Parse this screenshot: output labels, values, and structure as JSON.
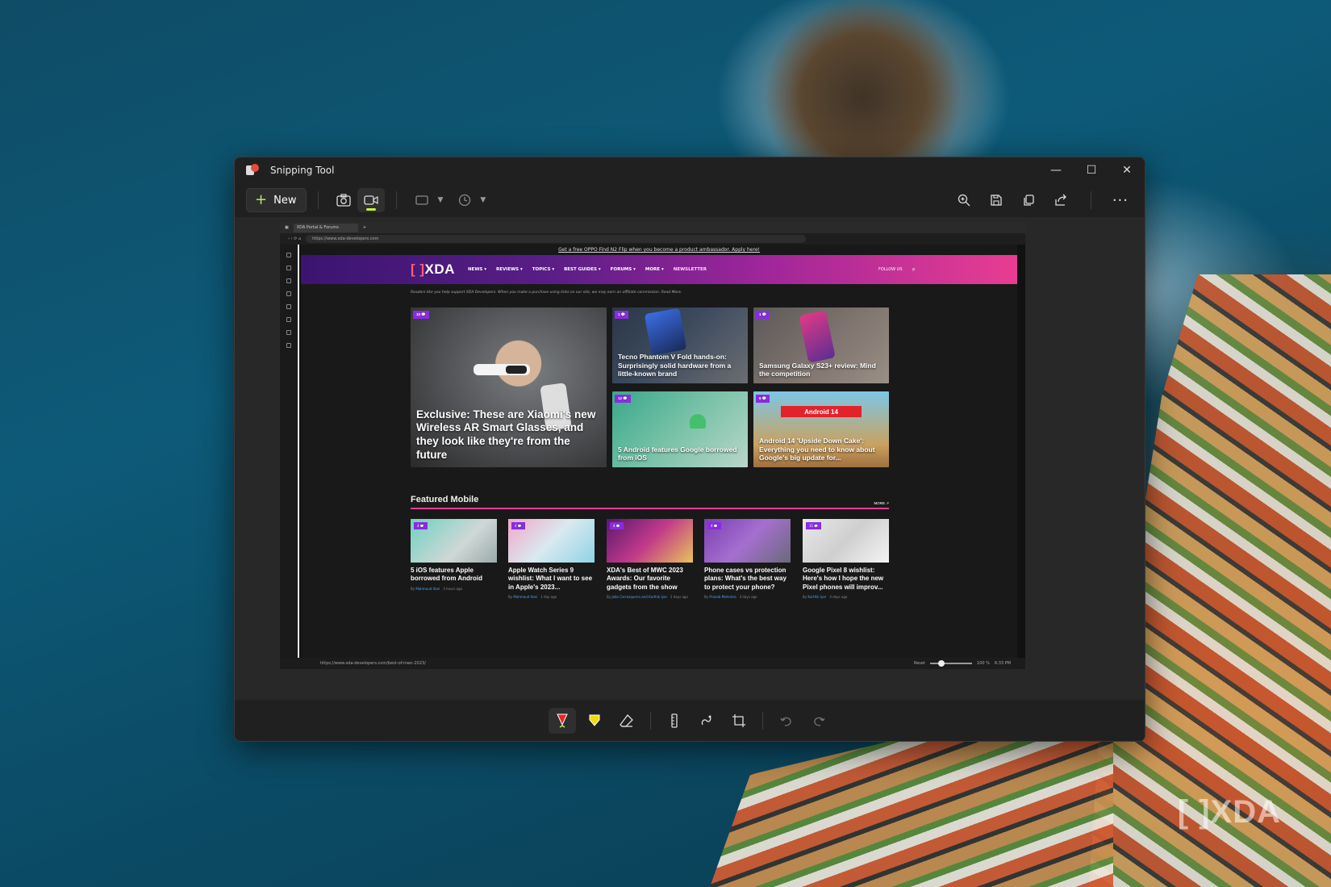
{
  "window": {
    "title": "Snipping Tool",
    "controls": {
      "minimize": "—",
      "maximize": "☐",
      "close": "✕"
    }
  },
  "toolbar": {
    "new_label": "New",
    "new_icon": "plus-icon",
    "tools": [
      "camera-icon",
      "video-icon",
      "rectangle-mode-icon",
      "timer-icon"
    ],
    "right_tools": [
      "zoom-in-icon",
      "save-icon",
      "copy-icon",
      "share-icon",
      "more-icon"
    ],
    "active_mode": "video",
    "accent": "#c6f23a"
  },
  "annotation_bar": {
    "tools": [
      "ballpoint-pen-icon",
      "highlighter-icon",
      "eraser-icon",
      "ruler-icon",
      "touch-writing-icon",
      "crop-icon",
      "undo-icon",
      "redo-icon"
    ],
    "active": "ballpoint-pen-icon"
  },
  "browser": {
    "tab_title": "XDA Portal & Forums",
    "url": "https://www.xda-developers.com",
    "status_url": "https://www.xda-developers.com/best-of-mwc-2023/",
    "zoom": "Reset",
    "zoom_percent": "100 %",
    "time": "6:33 PM"
  },
  "site": {
    "promo": "Get a free OPPO Find N2 Flip when you become a product ambassador. Apply here!",
    "logo_bracket": "[ ]",
    "logo_text": "XDA",
    "nav": [
      "NEWS ▾",
      "REVIEWS ▾",
      "TOPICS ▾",
      "BEST GUIDES ▾",
      "FORUMS ▾",
      "MORE ▾"
    ],
    "newsletter": "NEWSLETTER",
    "follow": "FOLLOW US",
    "disclaimer": "Readers like you help support XDA Developers. When you make a purchase using links on our site, we may earn an affiliate commission. Read More.",
    "brand_gradient": [
      "#3b1470",
      "#e83d92"
    ],
    "hero": {
      "main": {
        "badge": "10 💬",
        "title": "Exclusive: These are Xiaomi's new Wireless AR Smart Glasses, and they look like they're from the future"
      },
      "s1": {
        "badge": "1 💬",
        "title": "Tecno Phantom V Fold hands-on: Surprisingly solid hardware from a little-known brand"
      },
      "s2": {
        "badge": "1 💬",
        "title": "Samsung Galaxy S23+ review: Mind the competition"
      },
      "s3": {
        "badge": "12 💬",
        "title": "5 Android features Google borrowed from iOS"
      },
      "s4": {
        "badge": "5 💬",
        "banner": "Android 14",
        "title": "Android 14 'Upside Down Cake': Everything you need to know about Google's big update for..."
      }
    },
    "featured": {
      "title": "Featured Mobile",
      "more": "MORE ↗",
      "cards": [
        {
          "badge": "4 💬",
          "title": "5 iOS features Apple borrowed from Android",
          "by": "By",
          "author": "Mahmoud Itani",
          "time": "3 hours ago"
        },
        {
          "badge": "4 💬",
          "title": "Apple Watch Series 9 wishlist: What I want to see in Apple's 2023...",
          "by": "By",
          "author": "Mahmoud Itani",
          "time": "1 day ago"
        },
        {
          "badge": "4 💬",
          "title": "XDA's Best of MWC 2023 Awards: Our favorite gadgets from the show",
          "by": "By",
          "author": "João Carrasqueira and Karthik Iyer",
          "time": "2 days ago"
        },
        {
          "badge": "4 💬",
          "title": "Phone cases vs protection plans: What's the best way to protect your phone?",
          "by": "By",
          "author": "Pranob Mehrotra",
          "time": "3 days ago"
        },
        {
          "badge": "11 💬",
          "title": "Google Pixel 8 wishlist: Here's how I hope the new Pixel phones will improv...",
          "by": "By",
          "author": "Karthik Iyer",
          "time": "4 days ago"
        }
      ]
    }
  },
  "watermark": "[ ]XDA"
}
